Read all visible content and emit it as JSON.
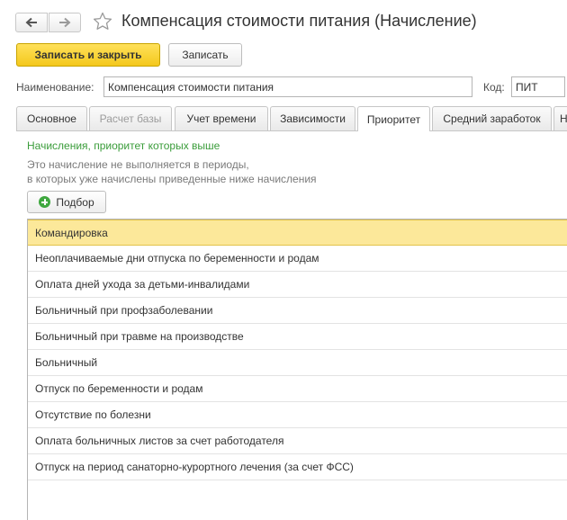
{
  "window": {
    "title": "Компенсация стоимости питания (Начисление)",
    "back_icon": "arrow-left-icon",
    "forward_icon": "arrow-right-icon",
    "favorite_icon": "star-icon"
  },
  "toolbar": {
    "save_close_label": "Записать и закрыть",
    "save_label": "Записать"
  },
  "form": {
    "name_label": "Наименование:",
    "name_value": "Компенсация стоимости питания",
    "code_label": "Код:",
    "code_value": "ПИТ"
  },
  "tabs": [
    {
      "label": "Основное",
      "state": "normal"
    },
    {
      "label": "Расчет базы",
      "state": "disabled"
    },
    {
      "label": "Учет времени",
      "state": "normal"
    },
    {
      "label": "Зависимости",
      "state": "normal"
    },
    {
      "label": "Приоритет",
      "state": "active"
    },
    {
      "label": "Средний заработок",
      "state": "normal"
    },
    {
      "label": "Н",
      "state": "normal"
    }
  ],
  "priority": {
    "heading": "Начисления, приоритет которых выше",
    "note_line1": "Это начисление не выполняется в периоды,",
    "note_line2": "в которых уже начислены приведенные ниже начисления",
    "pick_label": "Подбор",
    "pick_icon": "plus-circle-icon",
    "rows": [
      "Командировка",
      "Неоплачиваемые дни отпуска по беременности и родам",
      "Оплата дней ухода за детьми-инвалидами",
      "Больничный при профзаболевании",
      "Больничный при травме на производстве",
      "Больничный",
      "Отпуск по беременности и родам",
      "Отсутствие по болезни",
      "Оплата больничных листов за счет работодателя",
      "Отпуск на период санаторно-курортного лечения (за счет ФСС)"
    ],
    "selected_index": 0
  },
  "colors": {
    "accent_button": "#f4c81c",
    "selected_row": "#fce89a",
    "heading_green": "#3a9c3a"
  }
}
